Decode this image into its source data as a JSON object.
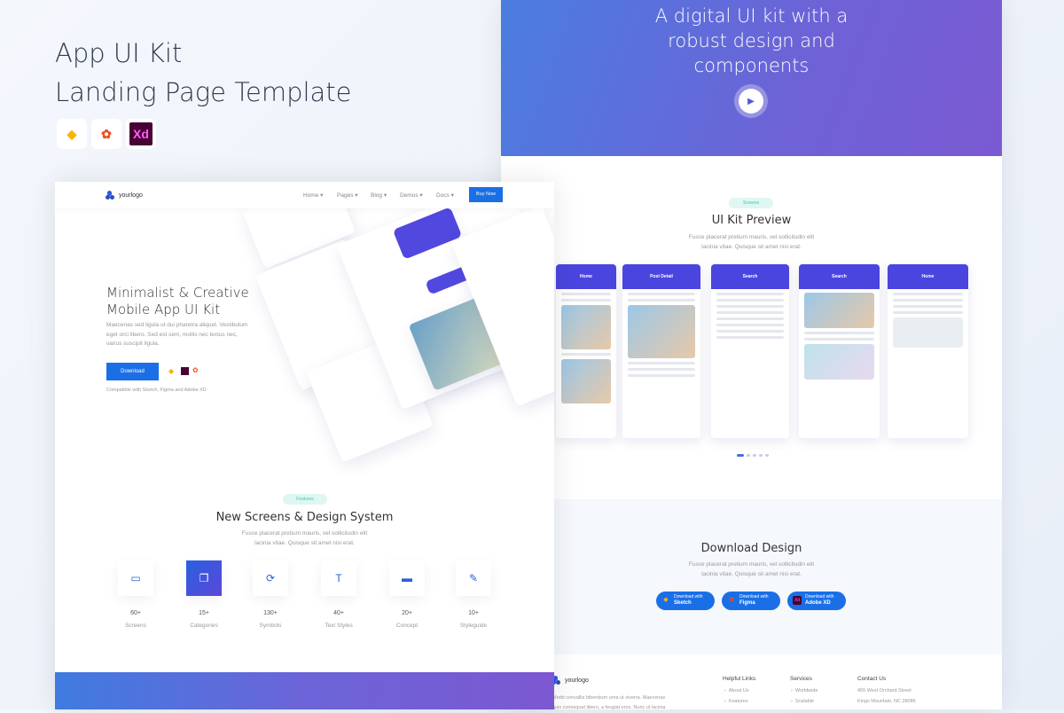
{
  "promo": {
    "title_line1": "App UI Kit",
    "title_line2": "Landing Page Template",
    "tools": [
      "Sketch",
      "Figma",
      "Xd"
    ]
  },
  "right": {
    "hero_title": "A digital UI kit with a robust design and components",
    "preview": {
      "badge": "Screens",
      "title": "UI Kit Preview",
      "subtitle_line1": "Fusce placerat pretium mauris, vel sollicitudin elit",
      "subtitle_line2": "lacinia vitae. Quisque sit amet nisi erat.",
      "screens": [
        {
          "header": "Home"
        },
        {
          "header": "Post Detail"
        },
        {
          "header": "Search"
        },
        {
          "header": "Search"
        },
        {
          "header": "Home"
        }
      ],
      "active_dot": 1
    },
    "download": {
      "title": "Download Design",
      "subtitle_line1": "Fusce placerat pretium mauris, vel sollicitudin elit",
      "subtitle_line2": "lacinia vitae. Quisque sit amet nisi erat.",
      "prefix": "Download with",
      "buttons": [
        "Sketch",
        "Figma",
        "Adobe XD"
      ]
    },
    "footer": {
      "logo": "yourlogo",
      "about_line1": "Morbi convallis bibendum urna ut viverra. Maecenas",
      "about_line2": "quis consequat libero, a feugiat eros. Nunc ut lacinia",
      "helpful_title": "Helpful Links",
      "helpful": [
        "About Us",
        "Features"
      ],
      "services_title": "Services",
      "services": [
        "Worldwide",
        "Scalable"
      ],
      "contact_title": "Contact Us",
      "contact": [
        "455 West Orchard Street",
        "Kings Mountain, NC 28086"
      ]
    }
  },
  "left": {
    "nav": {
      "logo": "yourlogo",
      "items": [
        "Home",
        "Pages",
        "Blog",
        "Demos",
        "Docs"
      ],
      "buy": "Buy Now"
    },
    "hero": {
      "title_line1": "Minimalist & Creative",
      "title_line2": "Mobile App UI Kit",
      "desc_line1": "Maecenas sed ligula ut dui pharetra aliquet. Vestibulum",
      "desc_line2": "eget orci libero. Sed est sem, mollis nec lectus nec,",
      "desc_line3": "varius suscipit ligula.",
      "download": "Download",
      "compat": "Compatible with Sketch, Figma and Adobe XD"
    },
    "features": {
      "badge": "Features",
      "title": "New Screens & Design System",
      "subtitle_line1": "Fusce placerat pretium mauris, vel sollicitudin elit",
      "subtitle_line2": "lacinia vitae. Quisque sit amet nisi erat.",
      "items": [
        {
          "icon": "monitor-icon",
          "glyph": "▭",
          "count": "60+",
          "label": "Screens"
        },
        {
          "icon": "copy-icon",
          "glyph": "❐",
          "count": "15+",
          "label": "Categories"
        },
        {
          "icon": "sync-icon",
          "glyph": "⟳",
          "count": "130+",
          "label": "Symbols"
        },
        {
          "icon": "text-icon",
          "glyph": "T",
          "count": "40+",
          "label": "Text Styles"
        },
        {
          "icon": "laptop-icon",
          "glyph": "▬",
          "count": "20+",
          "label": "Concept"
        },
        {
          "icon": "edit-icon",
          "glyph": "✎",
          "count": "10+",
          "label": "Styleguide"
        }
      ],
      "active_index": 1
    }
  },
  "colors": {
    "primary": "#1a6fe6",
    "accent": "#4b45e0"
  }
}
